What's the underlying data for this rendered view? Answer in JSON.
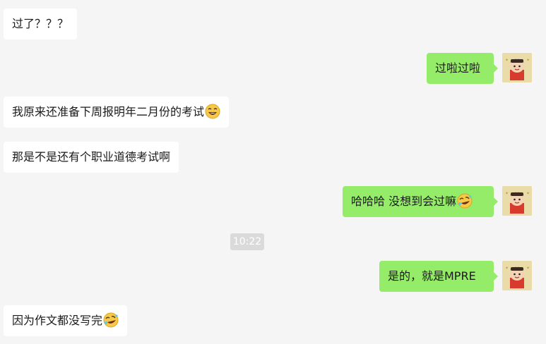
{
  "messages": [
    {
      "text": "过了？？？"
    },
    {
      "text": "过啦过啦"
    },
    {
      "text": "我原来还准备下周报明年二月份的考试",
      "emoji": "laughing-emoji"
    },
    {
      "text": "那是不是还有个职业道德考试啊"
    },
    {
      "text": "哈哈哈 没想到会过嘛",
      "emoji": "rolling-laughing-emoji"
    },
    {
      "text": "是的，就是MPRE"
    },
    {
      "text": "因为作文都没写完",
      "emoji": "rolling-laughing-emoji"
    }
  ],
  "timestamp": "10:22",
  "colors": {
    "background": "#f5f5f5",
    "incoming": "#ffffff",
    "outgoing": "#95ec69"
  }
}
